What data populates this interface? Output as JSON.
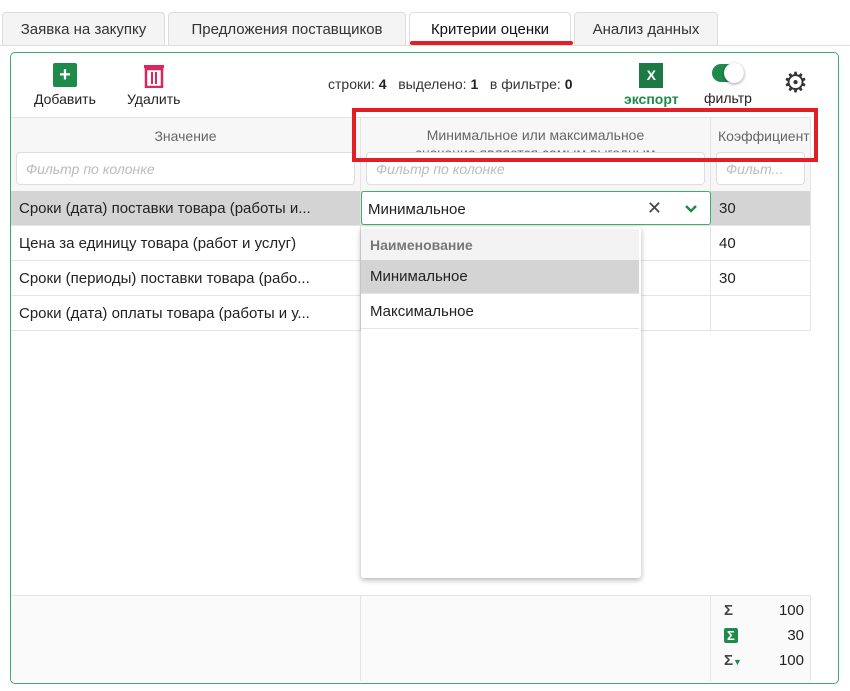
{
  "tabs": [
    {
      "label": "Заявка на закупку"
    },
    {
      "label": "Предложения поставщиков"
    },
    {
      "label": "Критерии оценки"
    },
    {
      "label": "Анализ данных"
    }
  ],
  "toolbar": {
    "add_label": "Добавить",
    "delete_label": "Удалить",
    "rows_label": "строки:",
    "rows": "4",
    "selected_label": "выделено:",
    "selected": "1",
    "filtered_label": "в фильтре:",
    "filtered": "0",
    "export_label": "экспорт",
    "export_icon": "X",
    "filter_label": "фильтр",
    "filter_on": true
  },
  "columns": [
    {
      "title": "Значение",
      "filter_placeholder": "Фильтр по колонке"
    },
    {
      "title": "Минимальное или максимальное",
      "title2": "значение является самым выгодным",
      "filter_placeholder": "Фильтр по колонке"
    },
    {
      "title": "Коэффициент",
      "filter_placeholder": "Фильт..."
    }
  ],
  "rows": [
    {
      "value": "Сроки (дата) поставки товара (работы и...",
      "minmax": "Минимальное",
      "coef": "30",
      "selected": true
    },
    {
      "value": "Цена за единицу товара (работ и услуг)",
      "minmax": "",
      "coef": "40"
    },
    {
      "value": "Сроки (периоды) поставки товара (рабо...",
      "minmax": "",
      "coef": "30"
    },
    {
      "value": "Сроки (дата) оплаты товара (работы и у...",
      "minmax": "",
      "coef": ""
    }
  ],
  "dropdown": {
    "header": "Наименование",
    "options": [
      "Минимальное",
      "Максимальное"
    ]
  },
  "footer": {
    "sum": "100",
    "selected_sum": "30",
    "filtered_sum": "100"
  },
  "colors": {
    "accent": "#1e8a4c",
    "highlight": "#e31e24",
    "selected_row": "#d4d4d4"
  }
}
